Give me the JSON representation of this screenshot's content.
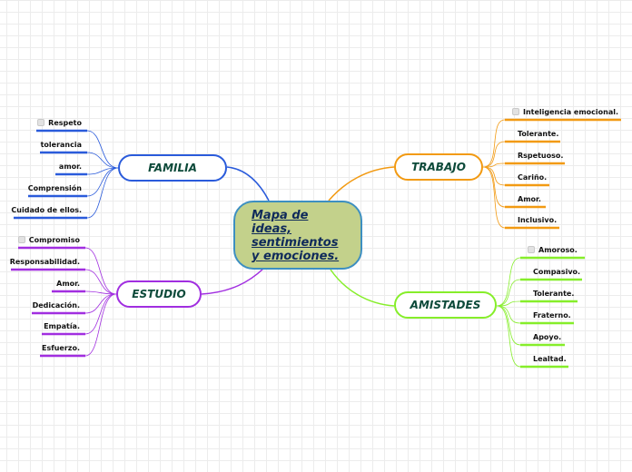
{
  "center": {
    "title": "Mapa de \nideas, \nsentimientos \ny emociones."
  },
  "colors": {
    "familia": "#2a5bdb",
    "estudio": "#a12ee0",
    "trabajo": "#f29a12",
    "amistades": "#86ee2a",
    "center_fill": "#c3d18b",
    "center_border": "#3d8fc1"
  },
  "branches": {
    "familia": {
      "label": "FAMILIA",
      "items": [
        "Respeto",
        "tolerancia",
        "amor.",
        "Comprensión",
        "Cuidado de ellos."
      ]
    },
    "estudio": {
      "label": "ESTUDIO",
      "items": [
        "Compromiso",
        "Responsabilidad.",
        "Amor.",
        "Dedicación.",
        "Empatía.",
        "Esfuerzo."
      ]
    },
    "trabajo": {
      "label": "TRABAJO",
      "items": [
        "Inteligencia emocional.",
        "Tolerante.",
        "Rspetuoso.",
        "Cariño.",
        "Amor.",
        "Inclusivo."
      ]
    },
    "amistades": {
      "label": "AMISTADES",
      "items": [
        "Amoroso.",
        "Compasivo.",
        "Tolerante.",
        "Fraterno.",
        "Apoyo.",
        "Lealtad."
      ]
    }
  }
}
